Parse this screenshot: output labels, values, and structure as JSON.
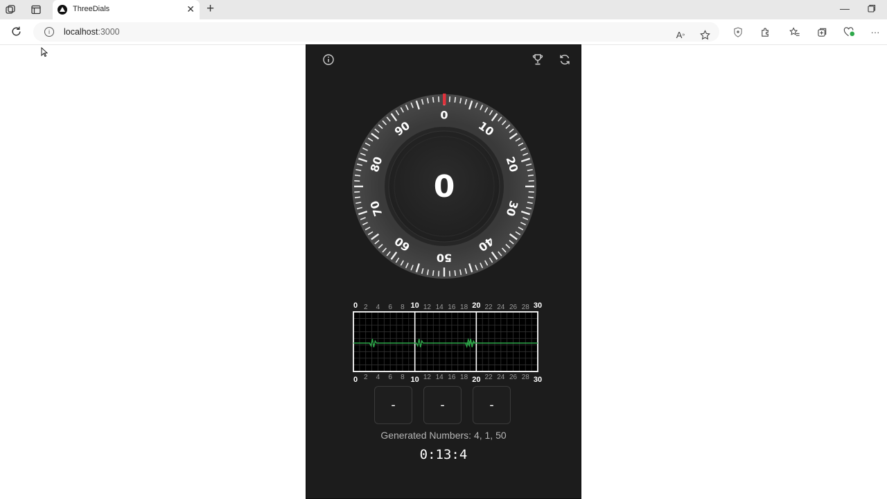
{
  "browser": {
    "tab_title": "ThreeDials",
    "url_host": "localhost",
    "url_port": ":3000"
  },
  "app": {
    "header_icons": [
      "info-icon",
      "trophy-icon",
      "refresh-icon"
    ],
    "dial": {
      "value": "0",
      "labels": [
        "0",
        "10",
        "20",
        "30",
        "40",
        "50",
        "60",
        "70",
        "80",
        "90"
      ],
      "marker_color": "#e0323c"
    },
    "ecg": {
      "major_labels": [
        "0",
        "10",
        "20",
        "30"
      ],
      "minor_labels": [
        "2",
        "4",
        "6",
        "8",
        "12",
        "14",
        "16",
        "18",
        "22",
        "24",
        "26",
        "28"
      ],
      "trace_color": "#2ea84a"
    },
    "slots": [
      "-",
      "-",
      "-"
    ],
    "generated_text": "Generated Numbers: 4, 1, 50",
    "timer": "0:13:4"
  }
}
